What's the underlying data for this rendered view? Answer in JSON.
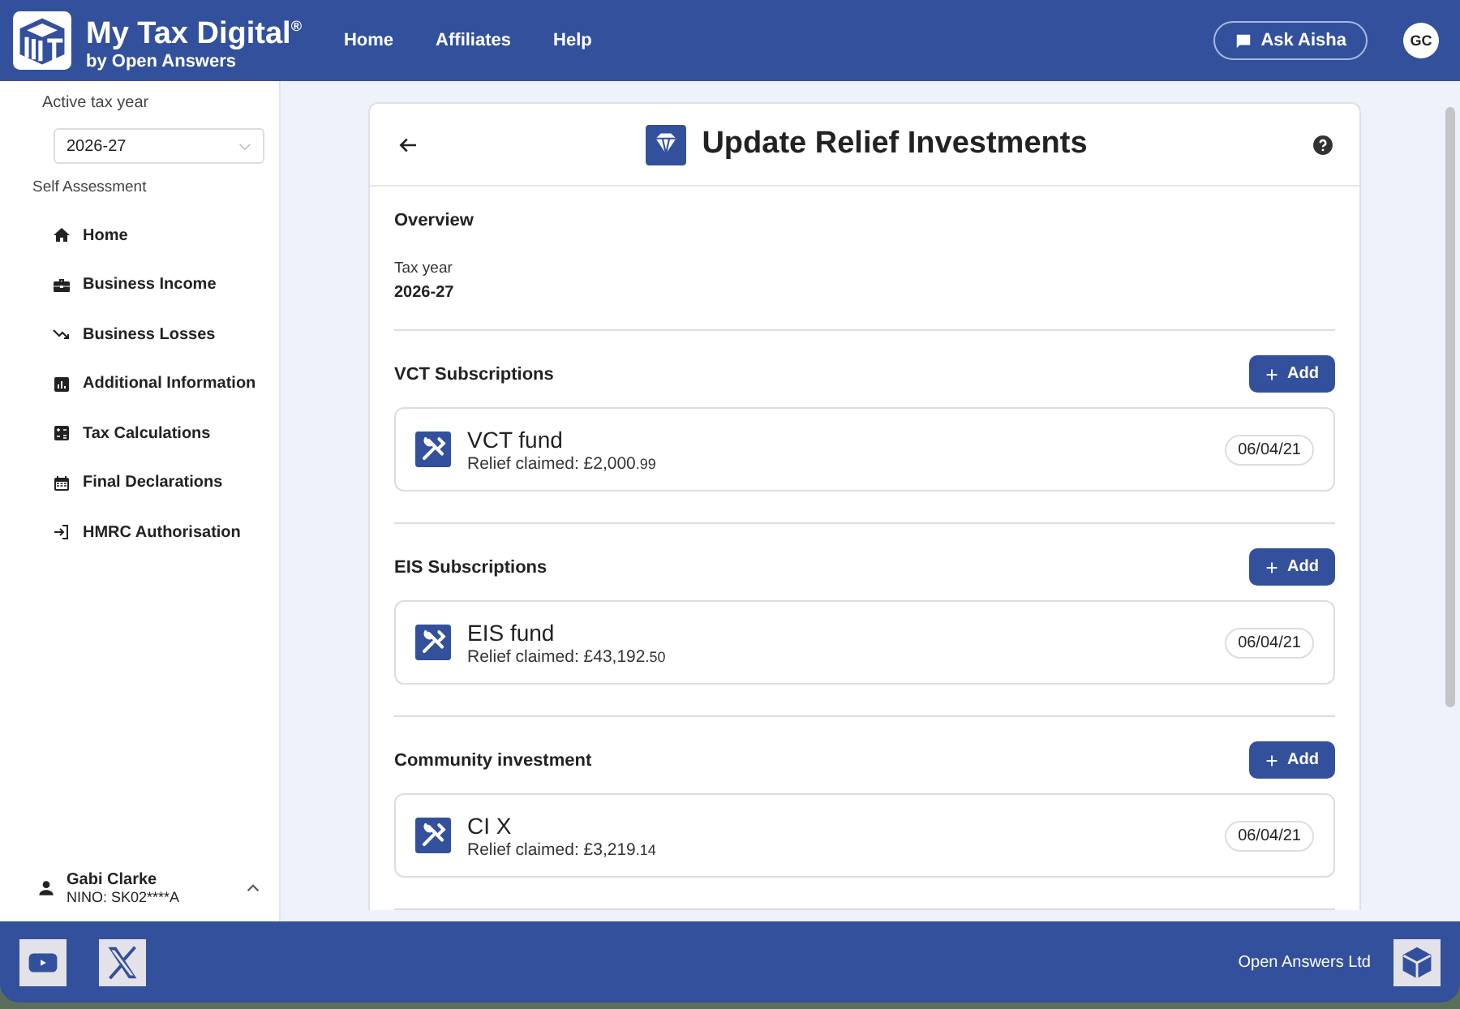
{
  "header": {
    "brand_title": "My Tax Digital$^{®}$",
    "brand_subtitle": "by Open Answers",
    "nav": [
      {
        "label": "Home"
      },
      {
        "label": "Affiliates"
      },
      {
        "label": "Help"
      }
    ],
    "ask_button": "Ask Aisha",
    "avatar": "GC"
  },
  "sidebar": {
    "tax_year_label": "Active tax year",
    "tax_year_select": "2026-27",
    "section_label": "Self Assessment",
    "items": [
      {
        "label": "Home",
        "kind": "home"
      },
      {
        "label": "Business Income",
        "kind": "income"
      },
      {
        "label": "Business Losses",
        "kind": "losses"
      },
      {
        "label": "Additional Information",
        "kind": "info"
      },
      {
        "label": "Tax Calculations",
        "kind": "calculations"
      },
      {
        "label": "Final Declarations",
        "kind": "declarations"
      },
      {
        "label": "HMRC Authorisation",
        "kind": "authorisation"
      }
    ],
    "user": {
      "name": "Gabi Clarke",
      "nino": "NINO: SK02****A"
    }
  },
  "page": {
    "title": "Update Relief Investments",
    "overview": {
      "heading": "Overview",
      "field_label": "Tax year",
      "field_value": "2026-27"
    },
    "sections": [
      {
        "heading": "VCT Subscriptions",
        "add_button": "Add",
        "items": [
          {
            "name": "VCT fund",
            "relief": "Relief claimed: £2,000",
            "pence": ".99",
            "date": "06/04/21"
          }
        ]
      },
      {
        "heading": "EIS Subscriptions",
        "add_button": "Add",
        "items": [
          {
            "name": "EIS fund",
            "relief": "Relief claimed: £43,192",
            "pence": ".50",
            "date": "06/04/21"
          }
        ]
      },
      {
        "heading": "Community investment",
        "add_button": "Add",
        "items": [
          {
            "name": "CI X",
            "relief": "Relief claimed: £3,219",
            "pence": ".14",
            "date": "06/04/21"
          }
        ]
      }
    ]
  },
  "footer": {
    "company": "Open Answers Ltd"
  }
}
